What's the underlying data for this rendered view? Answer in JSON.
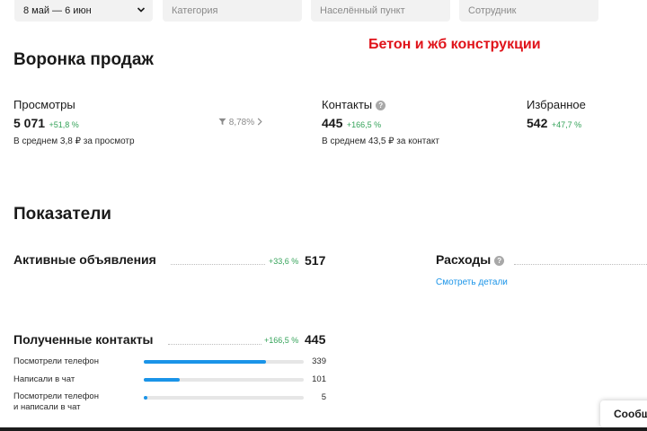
{
  "filters": {
    "date_range": "8 май — 6 июн",
    "category_placeholder": "Категория",
    "city_placeholder": "Населённый пункт",
    "employee_placeholder": "Сотрудник"
  },
  "overlay_title": "Бетон и жб конструкции",
  "funnel": {
    "title": "Воронка продаж",
    "views": {
      "label": "Просмотры",
      "value": "5 071",
      "change": "+51,8 %",
      "avg": "В среднем 3,8 ₽ за просмотр"
    },
    "conversion": "8,78%",
    "contacts": {
      "label": "Контакты",
      "value": "445",
      "change": "+166,5 %",
      "avg": "В среднем 43,5 ₽ за контакт"
    },
    "favorites": {
      "label": "Избранное",
      "value": "542",
      "change": "+47,7 %"
    }
  },
  "indicators": {
    "title": "Показатели",
    "active_ads": {
      "label": "Активные объявления",
      "change": "+33,6 %",
      "value": "517"
    },
    "expenses": {
      "label": "Расходы",
      "details_link": "Смотреть детали"
    },
    "contacts_received": {
      "label": "Полученные контакты",
      "change": "+166,5 %",
      "value": "445",
      "rows": [
        {
          "label": "Посмотрели телефон",
          "value": "339",
          "fraction": 0.762
        },
        {
          "label": "Написали в чат",
          "value": "101",
          "fraction": 0.227
        },
        {
          "label": "Посмотрели телефон\nи написали в чат",
          "value": "5",
          "fraction": 0.011
        }
      ]
    }
  },
  "chat_widget": {
    "label": "Сообщ"
  },
  "colors": {
    "accent": "#1a94e8",
    "positive": "#35a35a",
    "title_red": "#e0131a"
  }
}
